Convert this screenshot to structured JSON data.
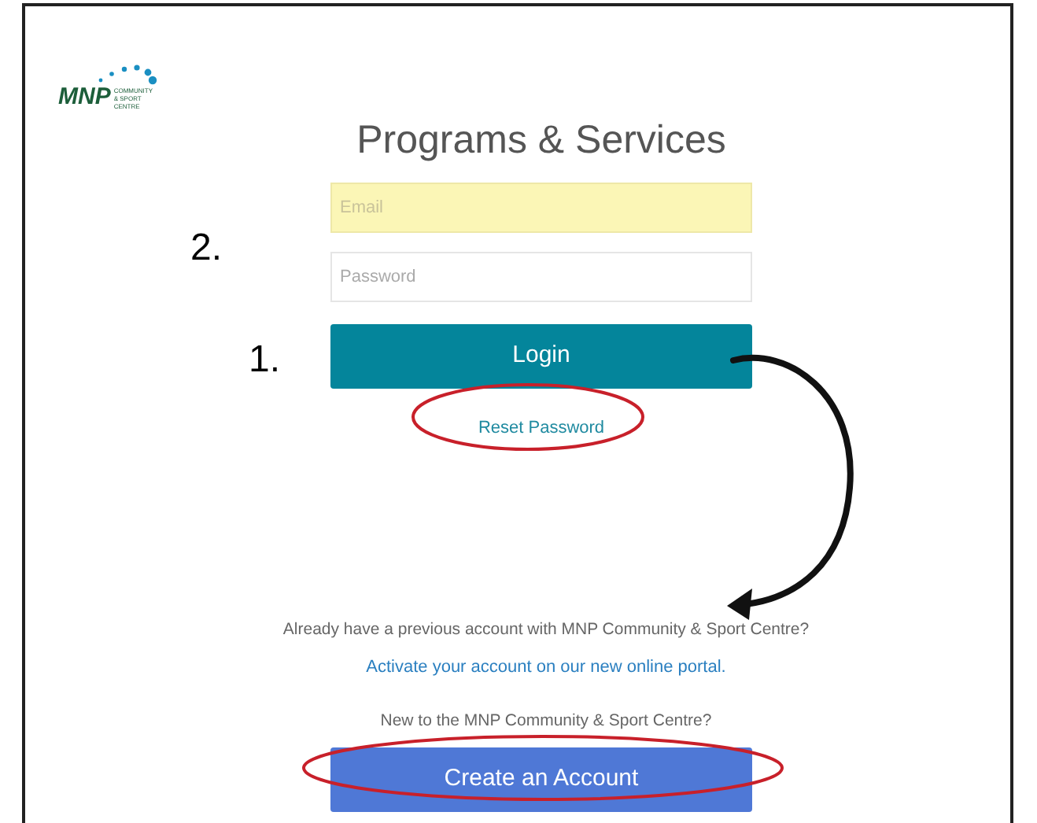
{
  "logo": {
    "name": "MNP",
    "tagline": "COMMUNITY & SPORT CENTRE"
  },
  "title": "Programs & Services",
  "fields": [
    {
      "placeholder": "Email",
      "autofilled": true
    },
    {
      "placeholder": "Password",
      "autofilled": false
    }
  ],
  "login_button": "Login",
  "reset_link": "Reset Password",
  "existing_account": {
    "text": "Already have a previous account with MNP Community & Sport Centre?",
    "link": "Activate your account on our new online portal."
  },
  "new_account": {
    "text": "New to the MNP Community & Sport Centre?",
    "button": "Create an Account"
  },
  "step_labels": [
    "2.",
    "1."
  ]
}
